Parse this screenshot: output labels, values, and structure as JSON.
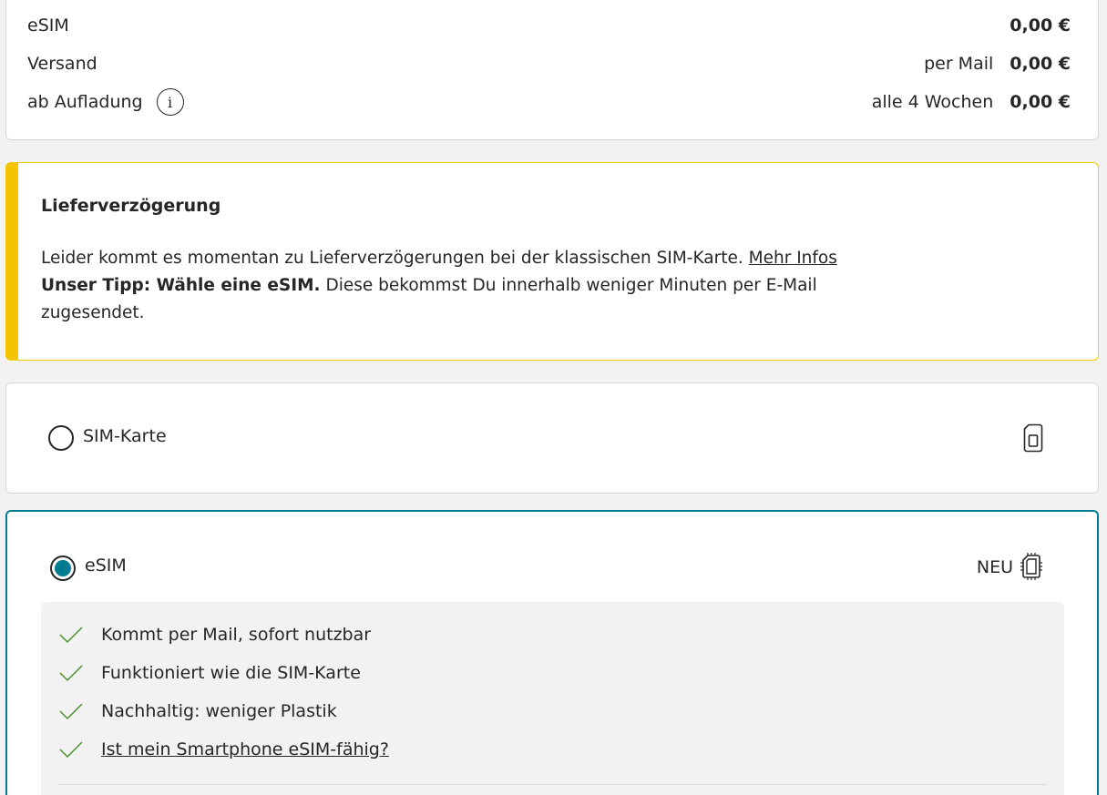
{
  "summary": {
    "rows": [
      {
        "label": "eSIM",
        "note": "",
        "price": "0,00 €"
      },
      {
        "label": "Versand",
        "note": "per Mail",
        "price": "0,00 €"
      },
      {
        "label": "ab Aufladung",
        "note": "alle 4 Wochen",
        "price": "0,00 €"
      }
    ],
    "info_glyph": "i"
  },
  "notice": {
    "title": "Lieferverzögerung",
    "text1": "Leider kommt es momentan zu Lieferverzögerungen bei der klassischen SIM-Karte.",
    "link": "Mehr Infos",
    "tip_bold": "Unser Tipp: Wähle eine eSIM.",
    "text2": "Diese bekommst Du innerhalb weniger Minuten per E-Mail zugesendet.",
    "accent_color": "#f5c400"
  },
  "options": {
    "simcard": {
      "label": "SIM-Karte",
      "selected": false,
      "icon": "sim-card-icon"
    },
    "esim": {
      "label": "eSIM",
      "selected": true,
      "badge": "NEU",
      "icon": "esim-chip-icon",
      "accent_color": "#007c92",
      "features": [
        "Kommt per Mail, sofort nutzbar",
        "Funktioniert wie die SIM-Karte",
        "Nachhaltig: weniger Plastik"
      ],
      "link": "Ist mein Smartphone eSIM-fähig?"
    }
  }
}
